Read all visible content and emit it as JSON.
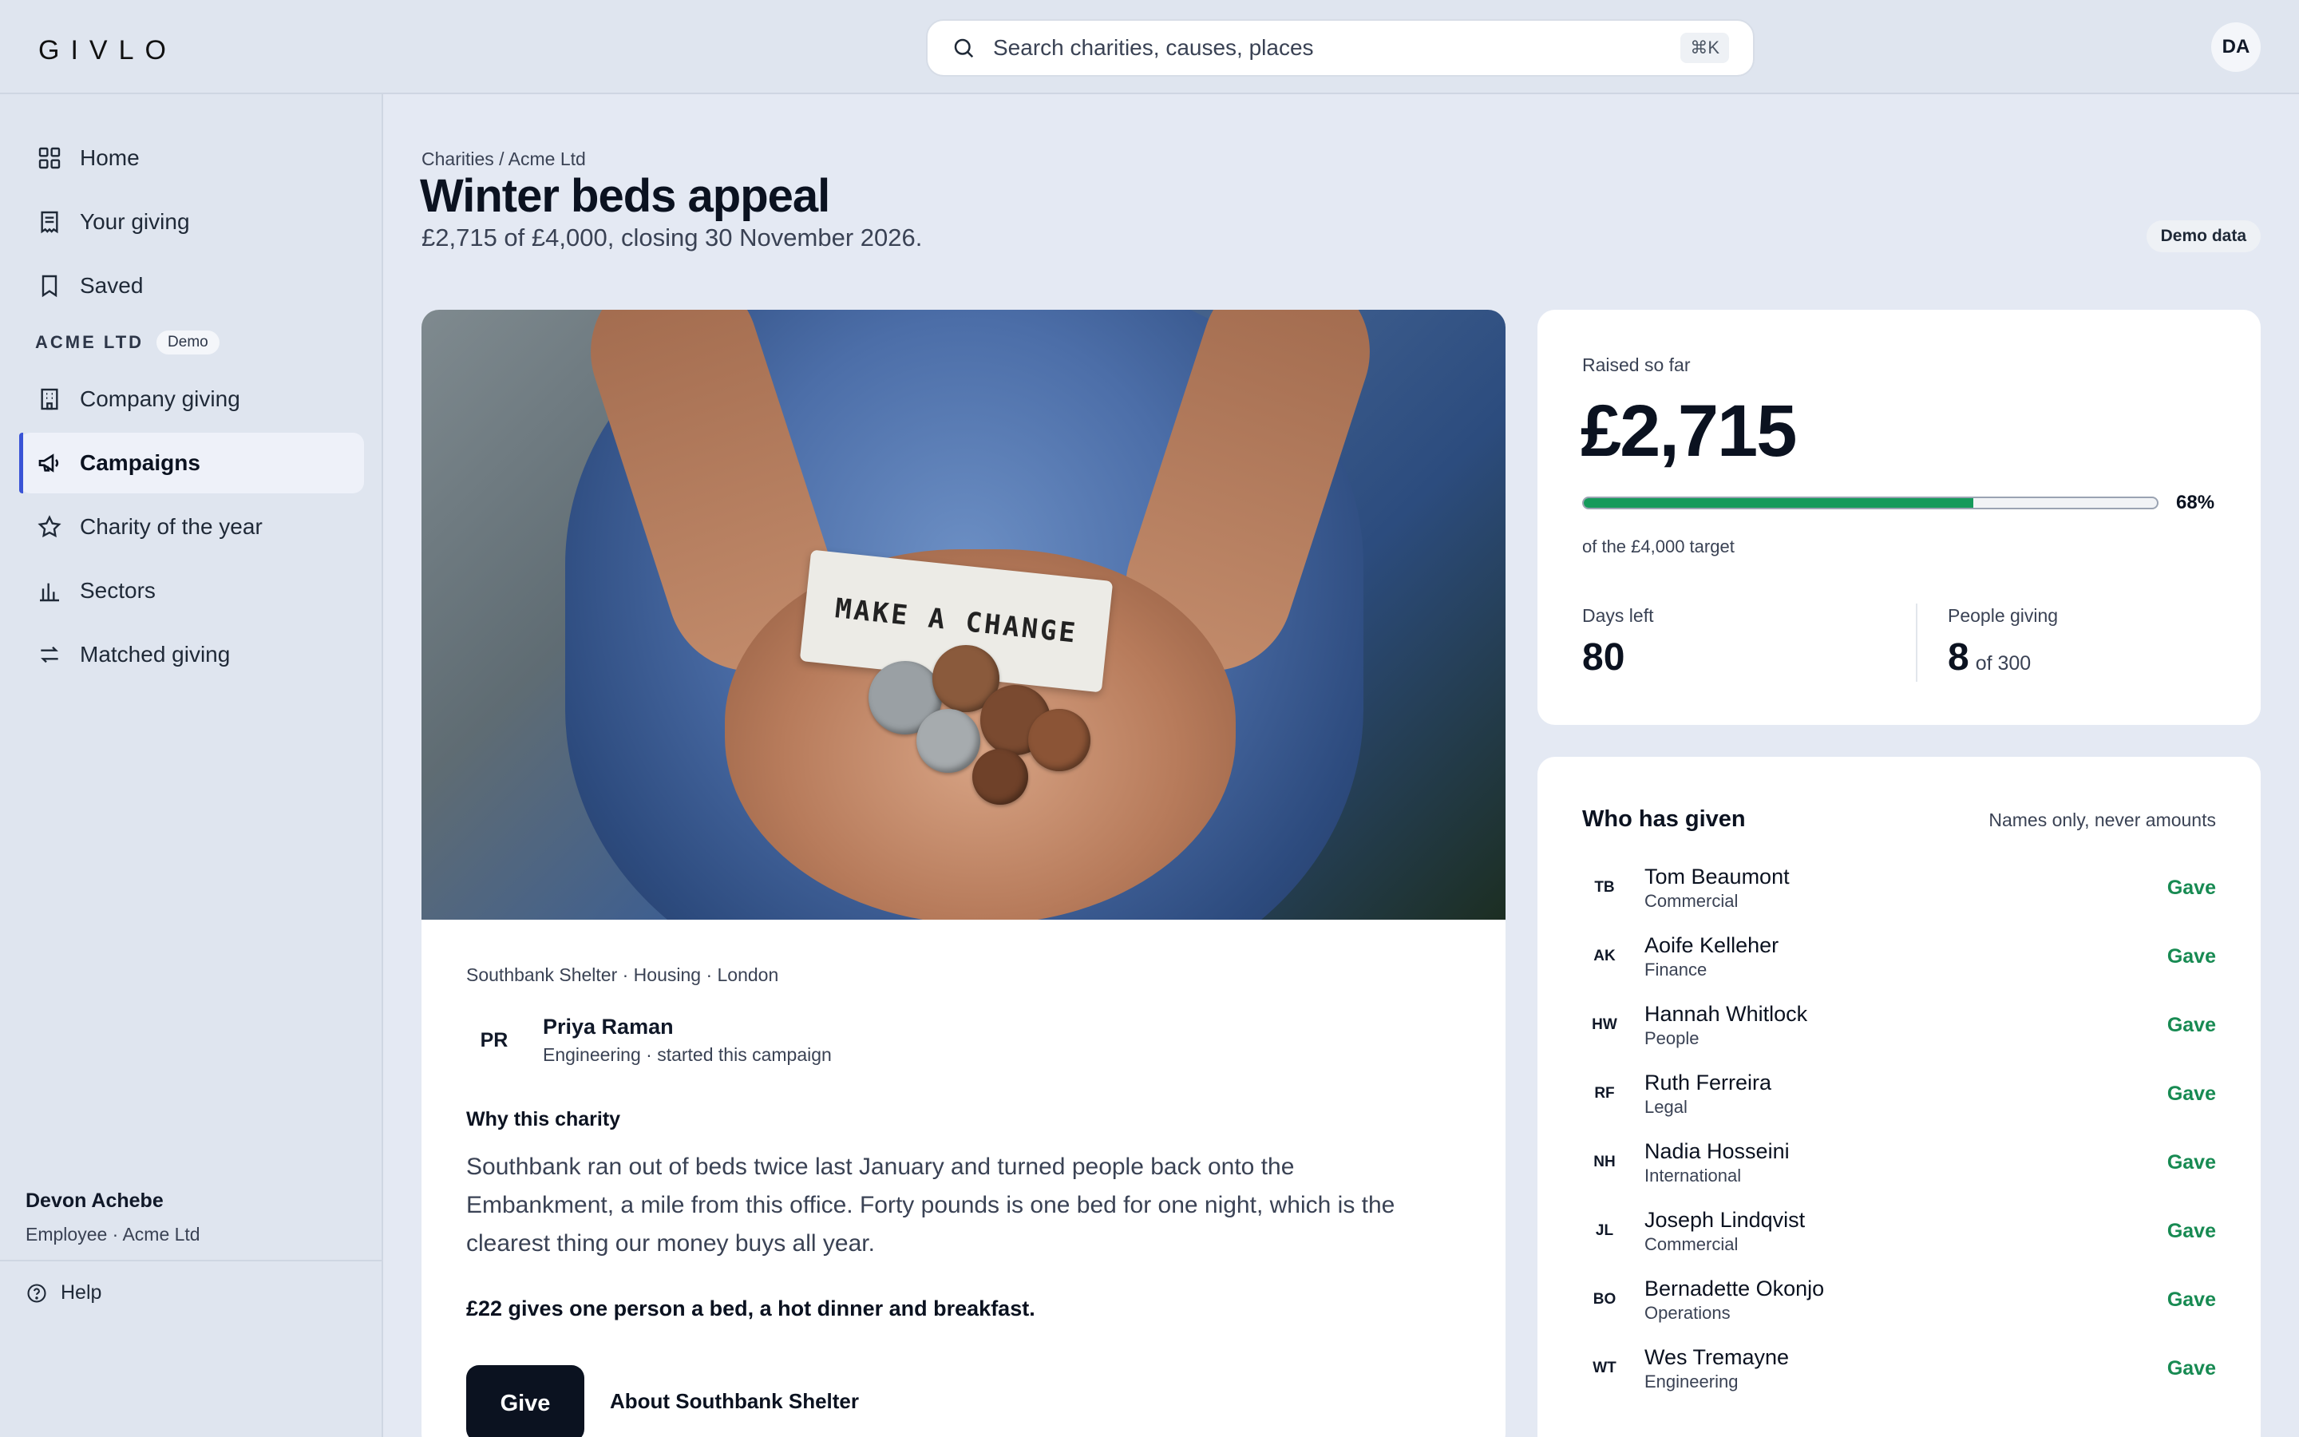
{
  "app": {
    "logo": "GIVLO"
  },
  "search": {
    "placeholder": "Search charities, causes, places",
    "shortcut": "⌘K"
  },
  "user_avatar": "DA",
  "sidebar": {
    "primary": [
      {
        "label": "Home",
        "icon": "grid-icon"
      },
      {
        "label": "Your giving",
        "icon": "receipt-icon"
      },
      {
        "label": "Saved",
        "icon": "bookmark-icon"
      }
    ],
    "org_label": "ACME LTD",
    "org_badge": "Demo",
    "org_items": [
      {
        "label": "Company giving",
        "icon": "building-icon"
      },
      {
        "label": "Campaigns",
        "icon": "megaphone-icon",
        "active": true
      },
      {
        "label": "Charity of the year",
        "icon": "star-icon"
      },
      {
        "label": "Sectors",
        "icon": "bar-chart-icon"
      },
      {
        "label": "Matched giving",
        "icon": "arrows-icon"
      }
    ],
    "user_name": "Devon Achebe",
    "user_role": "Employee · Acme Ltd",
    "help": "Help"
  },
  "page": {
    "breadcrumb": "Charities / Acme Ltd",
    "title": "Winter beds appeal",
    "subtitle": "£2,715 of £4,000, closing 30 November 2026.",
    "demo_chip": "Demo data"
  },
  "campaign": {
    "hero_note_text": "MAKE A CHANGE",
    "tagline": "Southbank Shelter · Housing · London",
    "organiser_initials": "PR",
    "organiser_name": "Priya Raman",
    "organiser_sub": "Engineering · started this campaign",
    "why_title": "Why this charity",
    "why_text": "Southbank ran out of beds twice last January and turned people back onto the Embankment, a mile from this office. Forty pounds is one bed for one night, which is the clearest thing our money buys all year.",
    "impact": "£22 gives one person a bed, a hot dinner and breakfast.",
    "give_label": "Give",
    "about_label": "About Southbank Shelter"
  },
  "raised": {
    "label": "Raised so far",
    "amount": "£2,715",
    "progress_fraction": 0.68,
    "progress_pct": "68%",
    "target": "of the £4,000 target",
    "days_label": "Days left",
    "days_value": "80",
    "people_label": "People giving",
    "people_value": "8",
    "people_of": "of 300",
    "accent_color": "#159a5b"
  },
  "donors": {
    "title": "Who has given",
    "note": "Names only, never amounts",
    "list": [
      {
        "initials": "TB",
        "name": "Tom Beaumont",
        "dept": "Commercial",
        "status": "Gave"
      },
      {
        "initials": "AK",
        "name": "Aoife Kelleher",
        "dept": "Finance",
        "status": "Gave"
      },
      {
        "initials": "HW",
        "name": "Hannah Whitlock",
        "dept": "People",
        "status": "Gave"
      },
      {
        "initials": "RF",
        "name": "Ruth Ferreira",
        "dept": "Legal",
        "status": "Gave"
      },
      {
        "initials": "NH",
        "name": "Nadia Hosseini",
        "dept": "International",
        "status": "Gave"
      },
      {
        "initials": "JL",
        "name": "Joseph Lindqvist",
        "dept": "Commercial",
        "status": "Gave"
      },
      {
        "initials": "BO",
        "name": "Bernadette Okonjo",
        "dept": "Operations",
        "status": "Gave"
      },
      {
        "initials": "WT",
        "name": "Wes Tremayne",
        "dept": "Engineering",
        "status": "Gave"
      }
    ]
  }
}
